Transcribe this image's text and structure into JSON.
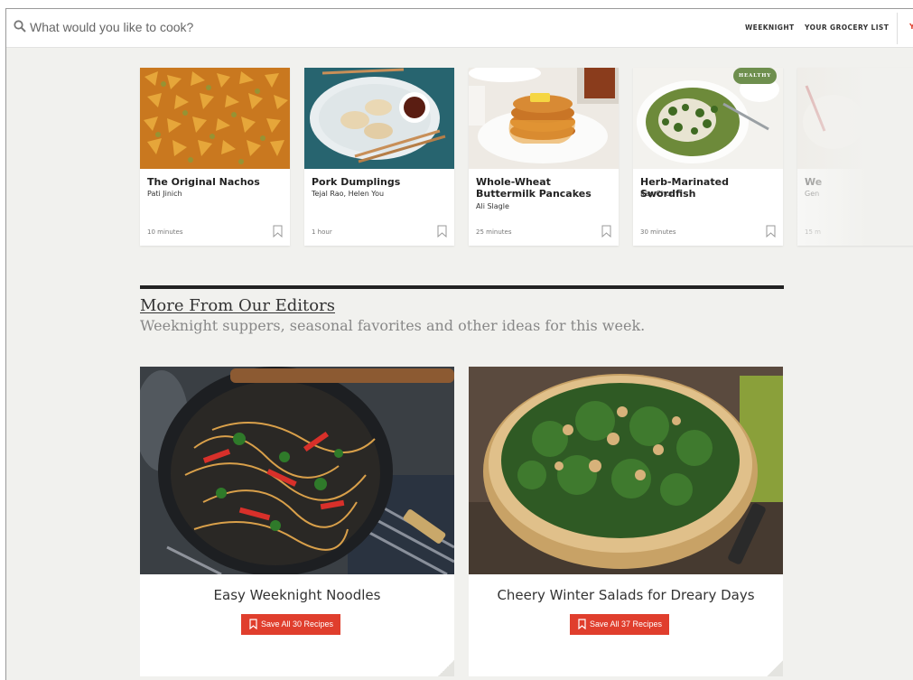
{
  "search": {
    "placeholder": "What would you like to cook?"
  },
  "nav": {
    "items": [
      "WEEKNIGHT",
      "YOUR GROCERY LIST"
    ],
    "cut_label": "Y"
  },
  "recipes": [
    {
      "title": "The Original Nachos",
      "author": "Pati Jinich",
      "time": "10 minutes",
      "badge": ""
    },
    {
      "title": "Pork Dumplings",
      "author": "Tejal Rao, Helen You",
      "time": "1 hour",
      "badge": ""
    },
    {
      "title": "Whole-Wheat Buttermilk Pancakes",
      "author": "Ali Slagle",
      "time": "25 minutes",
      "badge": ""
    },
    {
      "title": "Herb-Marinated Swordfish",
      "author": "Kay Chun",
      "time": "30 minutes",
      "badge": "HEALTHY"
    },
    {
      "title": "We",
      "author": "Gen",
      "time": "15 m",
      "badge": ""
    }
  ],
  "section": {
    "title": "More From Our Editors",
    "subtitle": "Weeknight suppers, seasonal favorites and other ideas for this week."
  },
  "collections": [
    {
      "title": "Easy Weeknight Noodles",
      "button": "Save All 30 Recipes"
    },
    {
      "title": "Cheery Winter Salads for Dreary Days",
      "button": "Save All 37 Recipes"
    }
  ],
  "colors": {
    "accent": "#e03e2d",
    "background": "#f1f1ee",
    "badge": "#6e8f4e"
  }
}
